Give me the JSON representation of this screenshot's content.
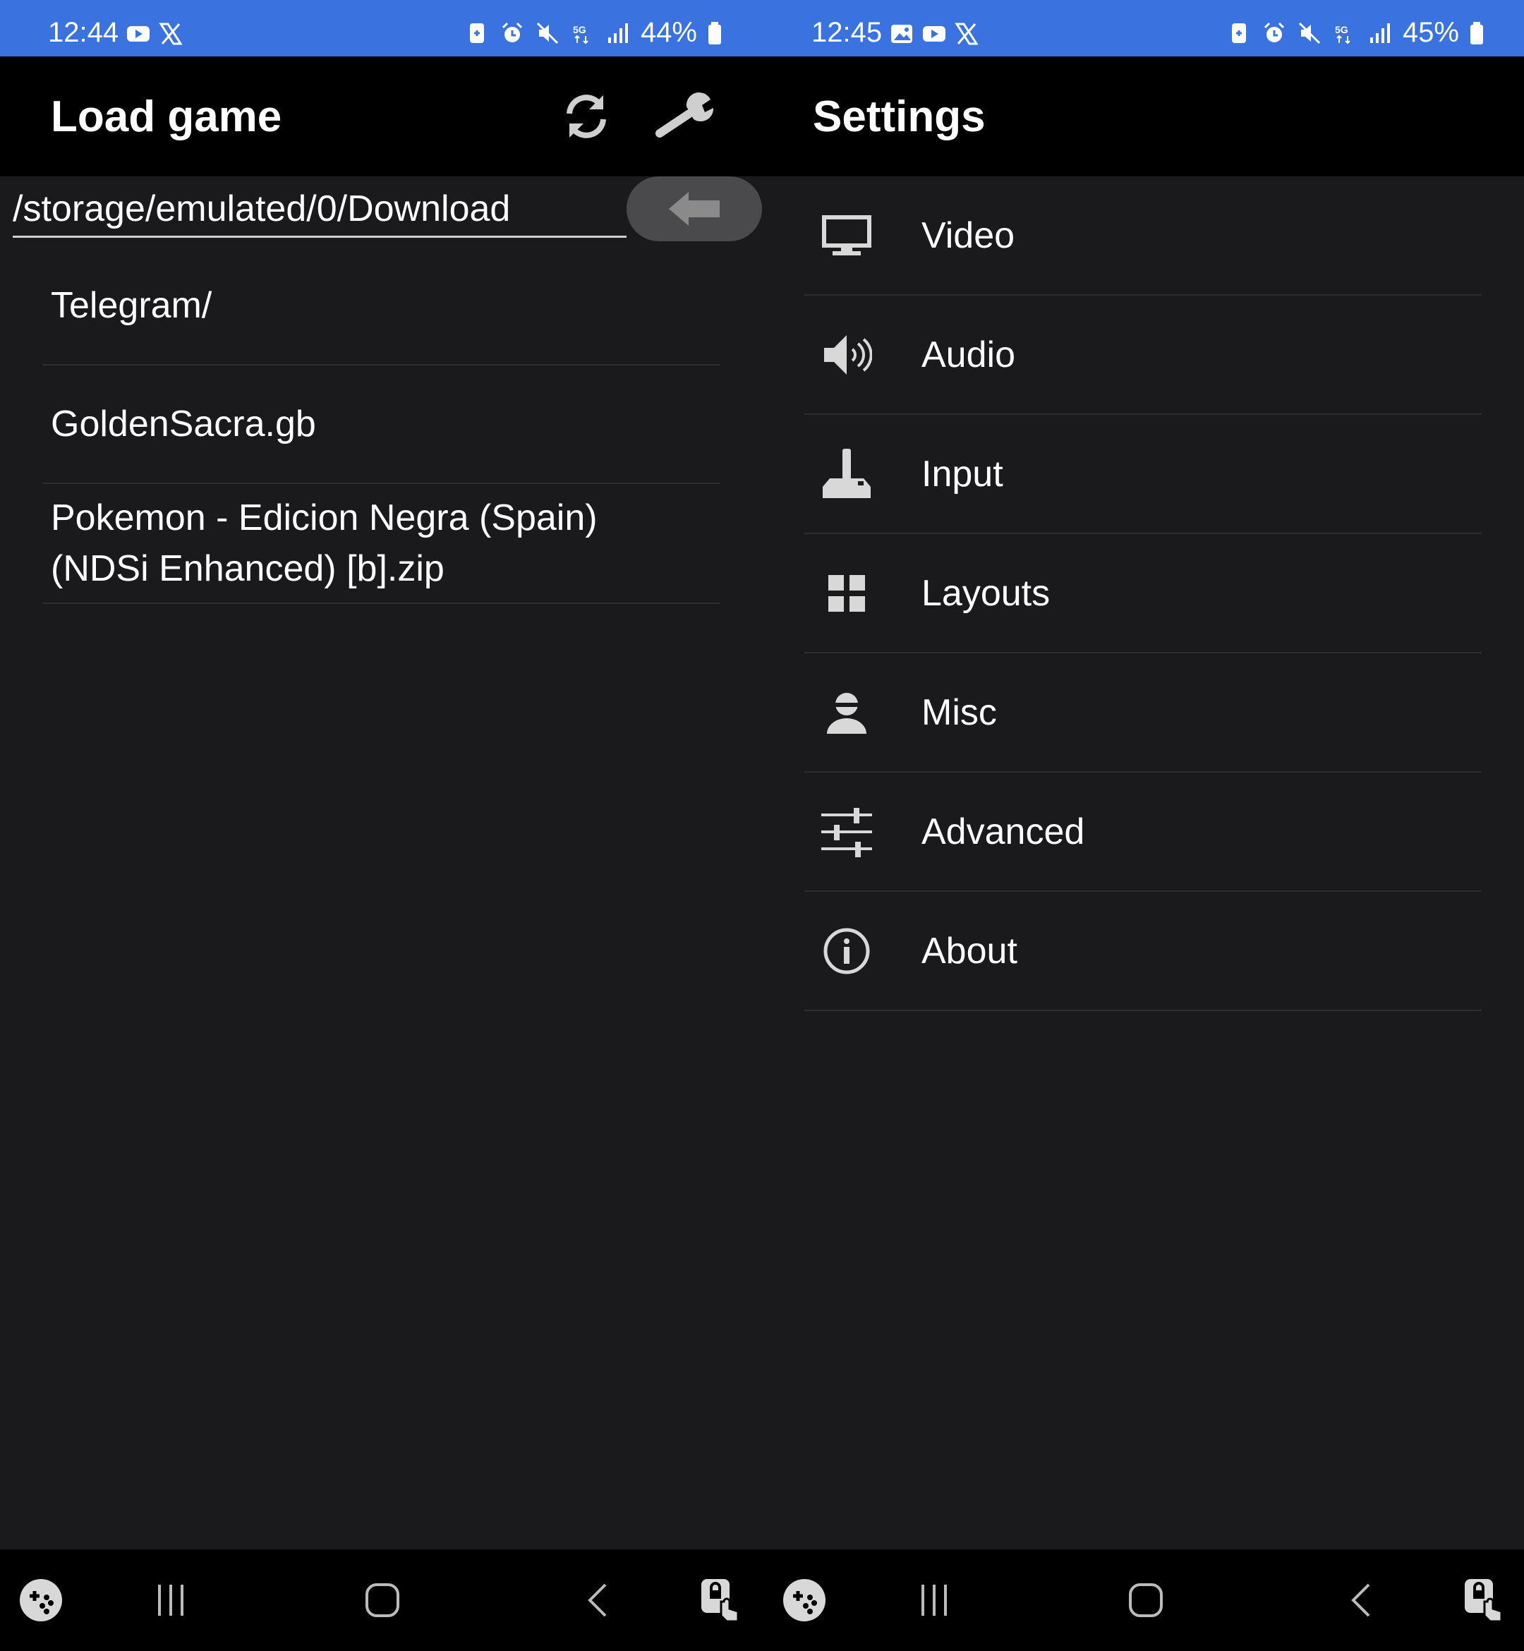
{
  "left": {
    "status": {
      "time": "12:44",
      "battery": "44%"
    },
    "appbar": {
      "title": "Load game"
    },
    "path": {
      "value": "/storage/emulated/0/Download"
    },
    "files": [
      {
        "name": "Telegram/"
      },
      {
        "name": "GoldenSacra.gb"
      },
      {
        "name": "Pokemon - Edicion Negra (Spain) (NDSi Enhanced) [b].zip"
      }
    ]
  },
  "right": {
    "status": {
      "time": "12:45",
      "battery": "45%"
    },
    "appbar": {
      "title": "Settings"
    },
    "settings": [
      {
        "label": "Video",
        "icon": "monitor-icon"
      },
      {
        "label": "Audio",
        "icon": "speaker-icon"
      },
      {
        "label": "Input",
        "icon": "joystick-icon"
      },
      {
        "label": "Layouts",
        "icon": "grid-icon"
      },
      {
        "label": "Misc",
        "icon": "person-icon"
      },
      {
        "label": "Advanced",
        "icon": "sliders-icon"
      },
      {
        "label": "About",
        "icon": "info-icon"
      }
    ]
  },
  "colors": {
    "statusbar": "#3a73e0",
    "background": "#1a1a1c",
    "appbar": "#000000",
    "divider": "#2e2e30"
  }
}
